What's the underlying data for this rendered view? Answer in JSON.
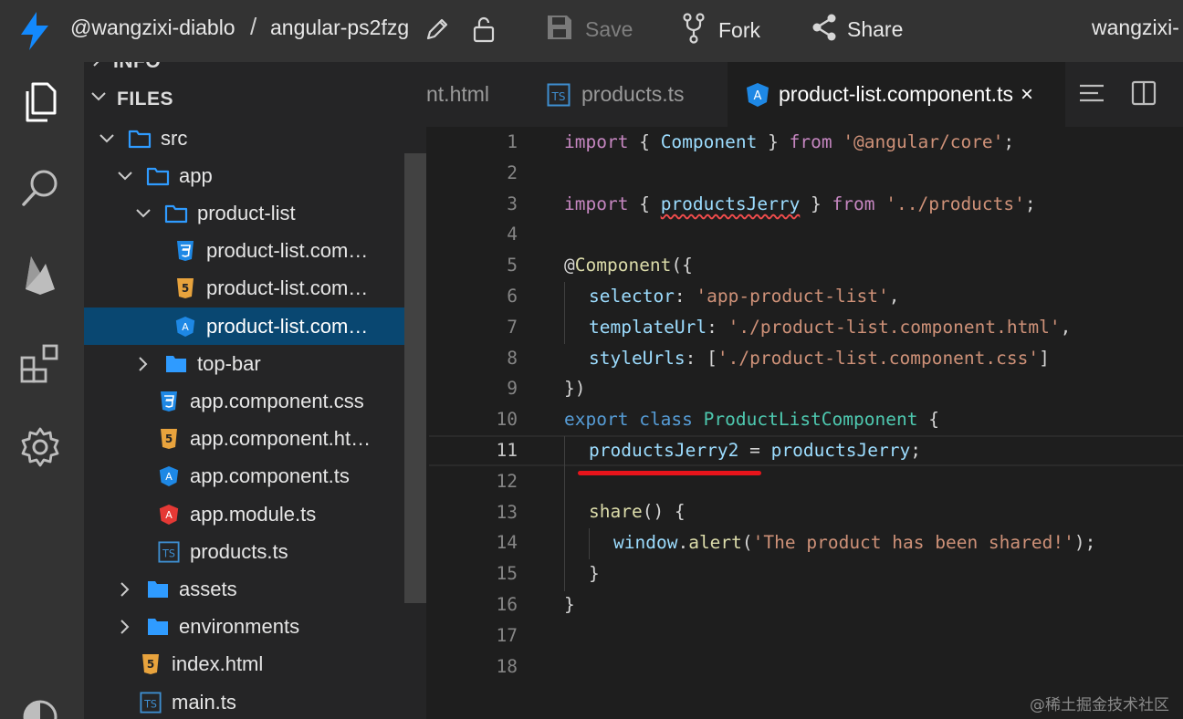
{
  "topbar": {
    "user": "@wangzixi-diablo",
    "slash": "/",
    "project": "angular-ps2fzg",
    "save_label": "Save",
    "fork_label": "Fork",
    "share_label": "Share",
    "account": "wangzixi-"
  },
  "sidebar": {
    "info_label": "INFO",
    "files_label": "FILES",
    "tree": [
      {
        "label": "src",
        "icon": "folder-icon",
        "expanded": true
      },
      {
        "label": "app",
        "icon": "folder-icon",
        "expanded": true
      },
      {
        "label": "product-list",
        "icon": "folder-icon",
        "expanded": true
      },
      {
        "label": "product-list.com…",
        "icon": "css-file-icon"
      },
      {
        "label": "product-list.com…",
        "icon": "html-file-icon"
      },
      {
        "label": "product-list.com…",
        "icon": "angular-component-icon",
        "selected": true
      },
      {
        "label": "top-bar",
        "icon": "folder-icon",
        "expanded": false
      },
      {
        "label": "app.component.css",
        "icon": "css-file-icon"
      },
      {
        "label": "app.component.ht…",
        "icon": "html-file-icon"
      },
      {
        "label": "app.component.ts",
        "icon": "angular-component-icon"
      },
      {
        "label": "app.module.ts",
        "icon": "angular-module-icon"
      },
      {
        "label": "products.ts",
        "icon": "typescript-file-icon"
      },
      {
        "label": "assets",
        "icon": "folder-icon",
        "expanded": false
      },
      {
        "label": "environments",
        "icon": "folder-icon",
        "expanded": false
      },
      {
        "label": "index.html",
        "icon": "html-file-icon"
      },
      {
        "label": "main.ts",
        "icon": "typescript-file-icon"
      }
    ]
  },
  "tabs": [
    {
      "label": "nt.html",
      "active": false
    },
    {
      "label": "products.ts",
      "active": false
    },
    {
      "label": "product-list.component.ts",
      "active": true,
      "close": "×"
    }
  ],
  "editor": {
    "current_line": 11,
    "line_numbers": [
      "1",
      "2",
      "3",
      "4",
      "5",
      "6",
      "7",
      "8",
      "9",
      "10",
      "11",
      "12",
      "13",
      "14",
      "15",
      "16",
      "17",
      "18"
    ],
    "code": {
      "l1": {
        "a": "import",
        "b": " { ",
        "c": "Component",
        "d": " } ",
        "e": "from",
        "f": " ",
        "g": "'@angular/core'",
        "h": ";"
      },
      "l3": {
        "a": "import",
        "b": " { ",
        "c": "productsJerry",
        "d": " } ",
        "e": "from",
        "f": " ",
        "g": "'../products'",
        "h": ";"
      },
      "l5": {
        "a": "@",
        "b": "Component",
        "c": "({"
      },
      "l6": {
        "a": "selector",
        "b": ": ",
        "c": "'app-product-list'",
        "d": ","
      },
      "l7": {
        "a": "templateUrl",
        "b": ": ",
        "c": "'./product-list.component.html'",
        "d": ","
      },
      "l8": {
        "a": "styleUrls",
        "b": ": [",
        "c": "'./product-list.component.css'",
        "d": "]"
      },
      "l9": {
        "a": "})"
      },
      "l10": {
        "a": "export",
        "b": " ",
        "c": "class",
        "d": " ",
        "e": "ProductListComponent",
        "f": " {"
      },
      "l11": {
        "a": "productsJerry2",
        "b": " = ",
        "c": "productsJerry",
        "d": ";"
      },
      "l13": {
        "a": "share",
        "b": "() {"
      },
      "l14": {
        "a": "window",
        "b": ".",
        "c": "alert",
        "d": "(",
        "e": "'The product has been shared!'",
        "f": ");"
      },
      "l15": {
        "a": "}"
      },
      "l16": {
        "a": "}"
      }
    }
  },
  "watermark": "@稀土掘金技术社区",
  "colors": {
    "accent": "#0a84ff",
    "selection": "#094771",
    "annotation_red": "#e8141b"
  }
}
